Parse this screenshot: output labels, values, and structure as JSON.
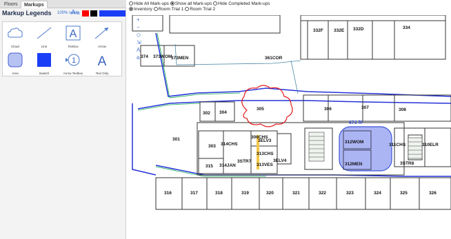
{
  "tabs": [
    {
      "label": "Floors"
    },
    {
      "label": "Markups"
    }
  ],
  "legend": {
    "title": "Markup Legends",
    "scale": "100% scale",
    "font_large": "A",
    "font_small": "a",
    "colors": [
      "#ff0000",
      "#000000",
      "#1a3ef5"
    ]
  },
  "palette": [
    {
      "label": "Cloud",
      "icon": "cloud-icon"
    },
    {
      "label": "Line",
      "icon": "line-icon"
    },
    {
      "label": "Textbox",
      "icon": "textbox-icon",
      "glyph": "A"
    },
    {
      "label": "Arrow",
      "icon": "arrow-icon"
    },
    {
      "label": "Area",
      "icon": "area-icon"
    },
    {
      "label": "Swatch",
      "icon": "swatch-icon"
    },
    {
      "label": "Arrow Textbox",
      "icon": "arrow-textbox-icon",
      "glyph": "1"
    },
    {
      "label": "Text Only",
      "icon": "text-only-icon",
      "glyph": "A"
    }
  ],
  "markup_options": {
    "hide_all": "Hide All Mark-ups",
    "show_all": "Show all Mark-ups",
    "hide_completed": "Hide Completed Mark-ups",
    "inventory": "Inventory",
    "trial1": "Room Trial 1",
    "trial2": "Room Trial 2"
  },
  "tools": [
    "+",
    "−",
    "◇",
    "⇲",
    "A",
    "a"
  ],
  "area_measure": "673 ft²",
  "rooms": {
    "r332F": "332F",
    "r332E": "332E",
    "r332D": "332D",
    "r334": "334",
    "r374": "374",
    "r373WOM": "373WOM",
    "r373MEN": "373MEN",
    "r361COR": "361COR",
    "r302": "302",
    "r304": "304",
    "r305": "305",
    "r306": "306",
    "r307": "307",
    "r308": "308",
    "r301": "301",
    "r303": "303",
    "r314CHS": "314CHS",
    "r306CHS": "306CHS",
    "r3ELV3": "3ELV3",
    "r313CHS": "313CHS",
    "r3ELV4": "3ELV4",
    "r3STR7": "3STR7",
    "r315": "315",
    "r314JAN": "314JAN",
    "r313VES": "313VES",
    "r312WOM": "312WOM",
    "r312MEN": "312MEN",
    "r311CHS": "311CHS",
    "r310ELR": "310ELR",
    "r3STR8": "3STR8",
    "r316": "316",
    "r317": "317",
    "r318": "318",
    "r319": "319",
    "r320": "320",
    "r321": "321",
    "r322": "322",
    "r323": "323",
    "r324": "324",
    "r325": "325",
    "r326": "326"
  }
}
